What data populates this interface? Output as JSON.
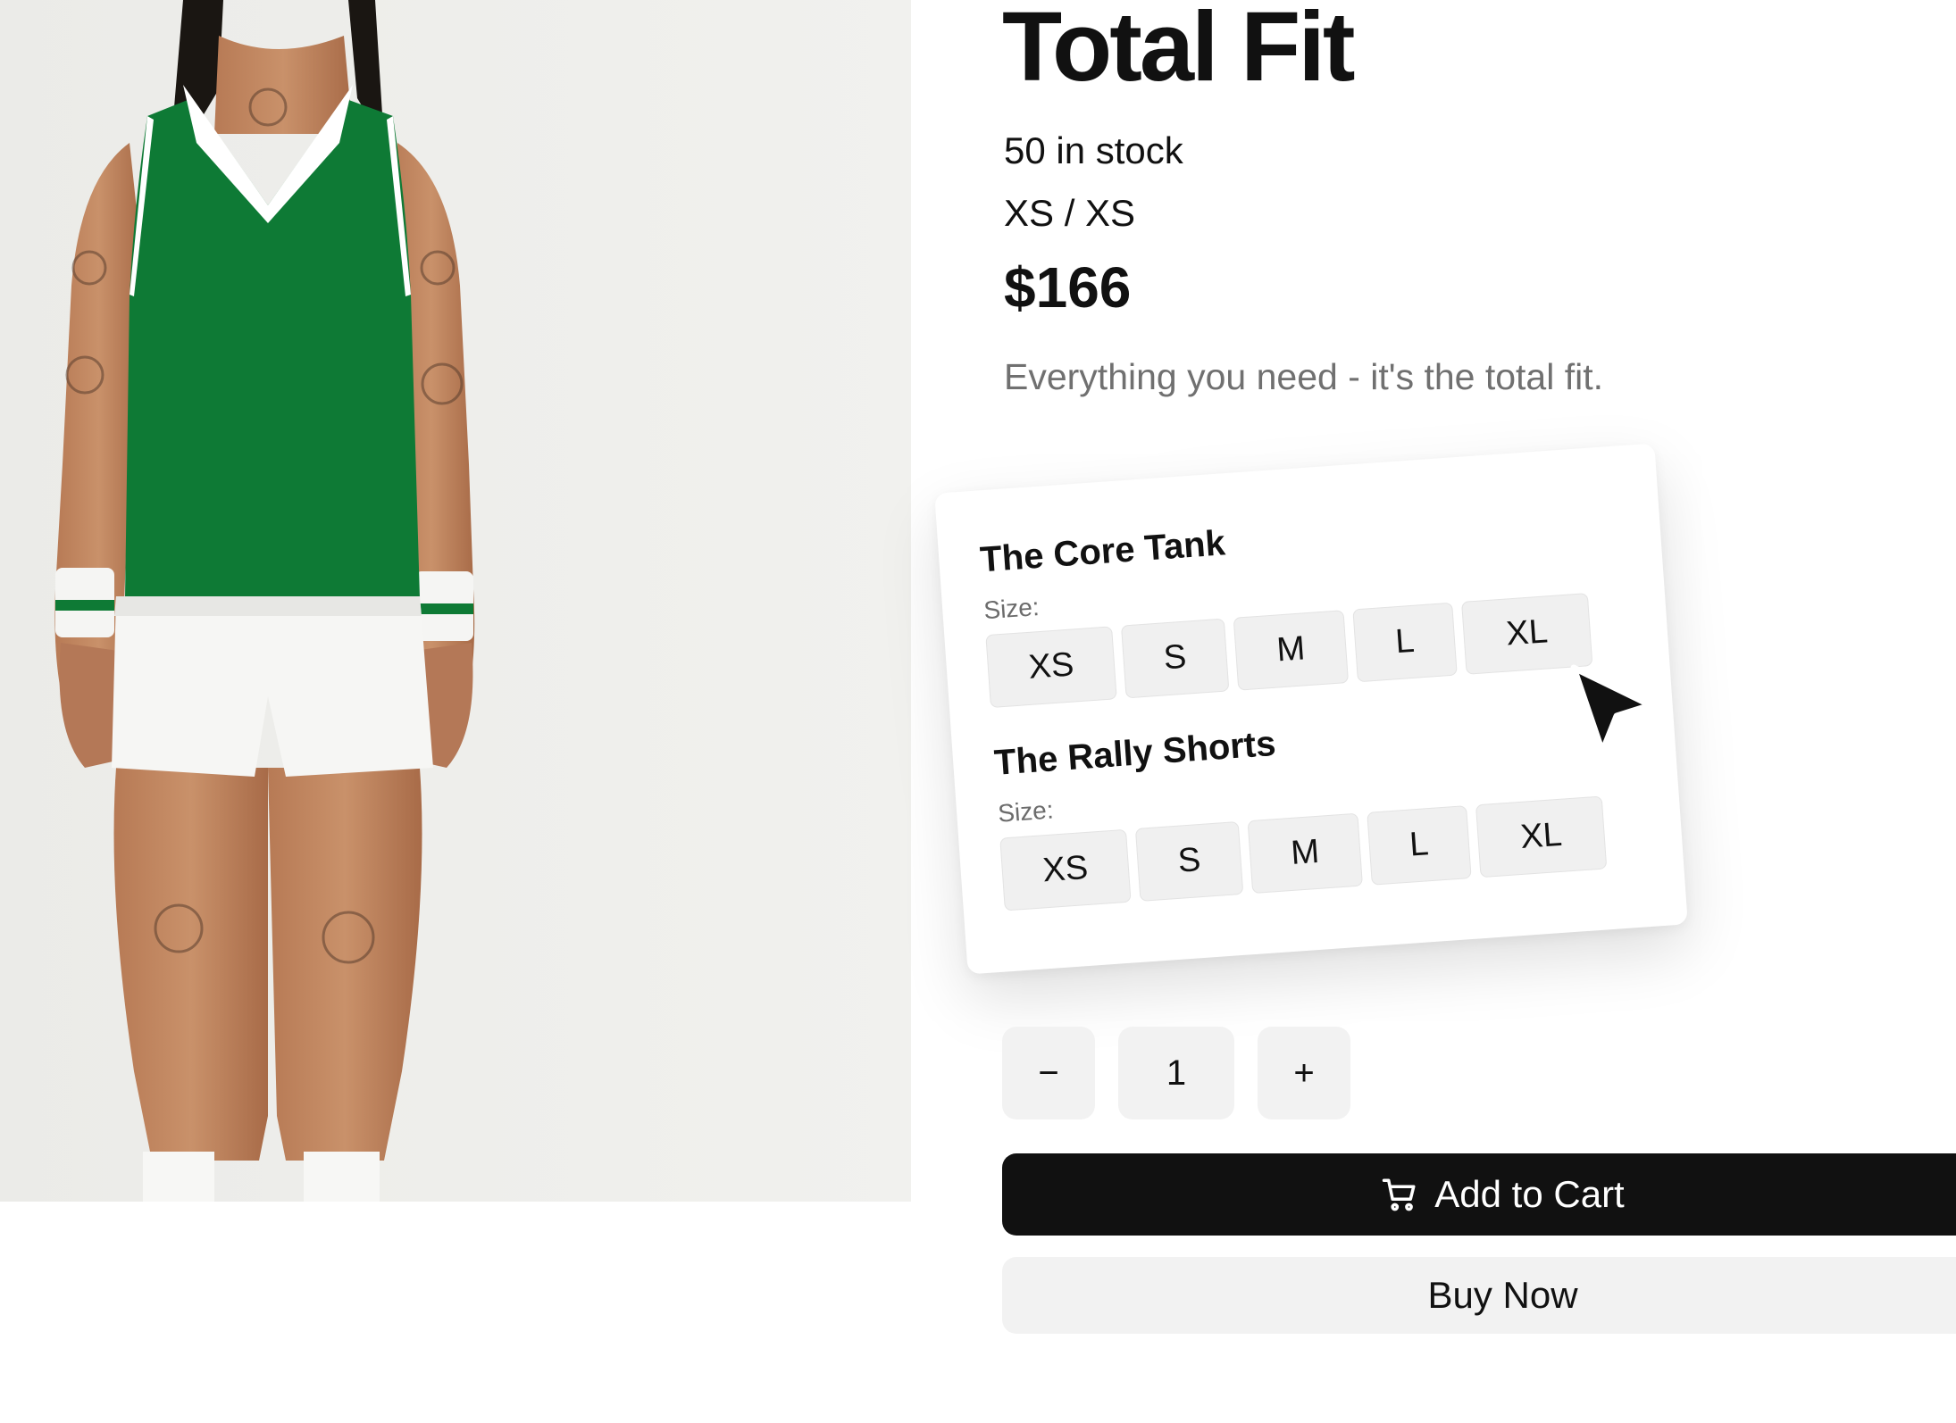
{
  "product": {
    "title": "Total Fit",
    "stock": "50 in stock",
    "variant": "XS / XS",
    "price": "$166",
    "description": "Everything you need - it's the total fit."
  },
  "bundle": [
    {
      "name": "The Core Tank",
      "size_label": "Size:",
      "sizes": [
        "XS",
        "S",
        "M",
        "L",
        "XL"
      ]
    },
    {
      "name": "The Rally Shorts",
      "size_label": "Size:",
      "sizes": [
        "XS",
        "S",
        "M",
        "L",
        "XL"
      ]
    }
  ],
  "quantity": {
    "minus": "−",
    "value": "1",
    "plus": "+"
  },
  "actions": {
    "add_to_cart": "Add to Cart",
    "buy_now": "Buy Now"
  },
  "icons": {
    "cart": "cart-icon",
    "cursor": "cursor-icon"
  },
  "colors": {
    "primary_button": "#111111",
    "secondary_button": "#f2f2f2",
    "tank": "#0e7a35"
  }
}
